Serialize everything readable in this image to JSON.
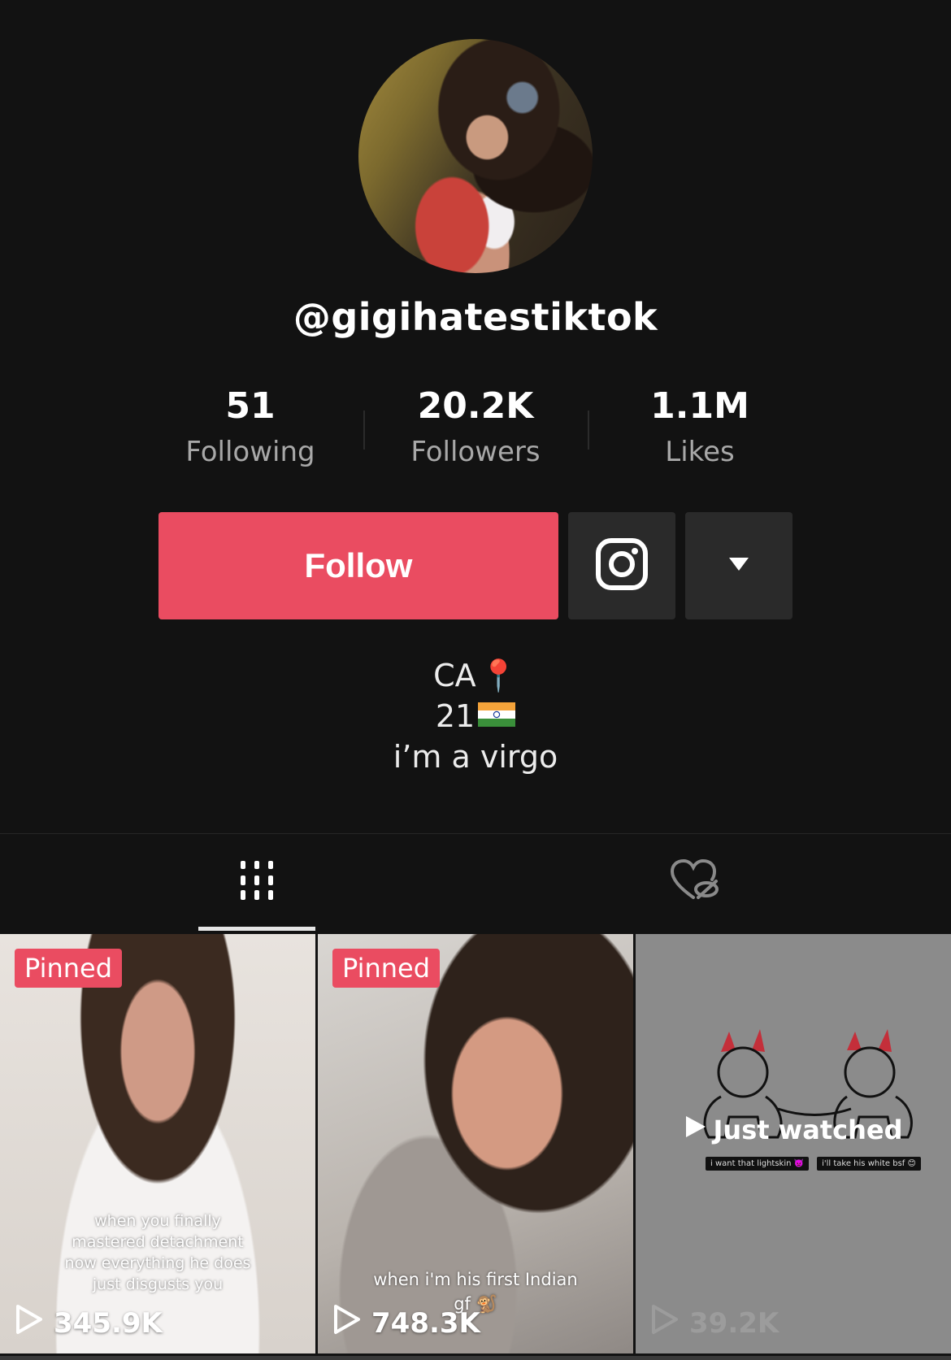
{
  "profile": {
    "username": "@gigihatestiktok"
  },
  "stats": [
    {
      "value": "51",
      "label": "Following"
    },
    {
      "value": "20.2K",
      "label": "Followers"
    },
    {
      "value": "1.1M",
      "label": "Likes"
    }
  ],
  "actions": {
    "follow_label": "Follow",
    "instagram_icon": "instagram-icon",
    "more_icon": "caret-down-icon"
  },
  "bio": {
    "line1": "CA",
    "line1_emoji": "📍",
    "line2": "21",
    "line2_emoji": "🇮🇳",
    "line3": "i’m a virgo"
  },
  "tabs": [
    {
      "name": "videos",
      "icon": "grid-bars-icon",
      "active": true
    },
    {
      "name": "liked",
      "icon": "heart-eye-slash-icon",
      "active": false
    }
  ],
  "videos": [
    {
      "pinned_label": "Pinned",
      "views": "345.9K",
      "caption": [
        "when you finally",
        "mastered detachment",
        "now everything he does",
        "just disgusts you"
      ]
    },
    {
      "pinned_label": "Pinned",
      "views": "748.3K",
      "caption": [
        "when i'm his first Indian",
        "gf 🐒"
      ]
    },
    {
      "just_watched": "Just watched",
      "views": "39.2K",
      "mini_labels": [
        "i want that lightskin 👿",
        "i'll take his white bsf 😊"
      ]
    }
  ],
  "colors": {
    "background": "#121212",
    "accent": "#ea4c61",
    "button_secondary": "#2a2a2a",
    "muted_text": "#a8a8a8"
  }
}
